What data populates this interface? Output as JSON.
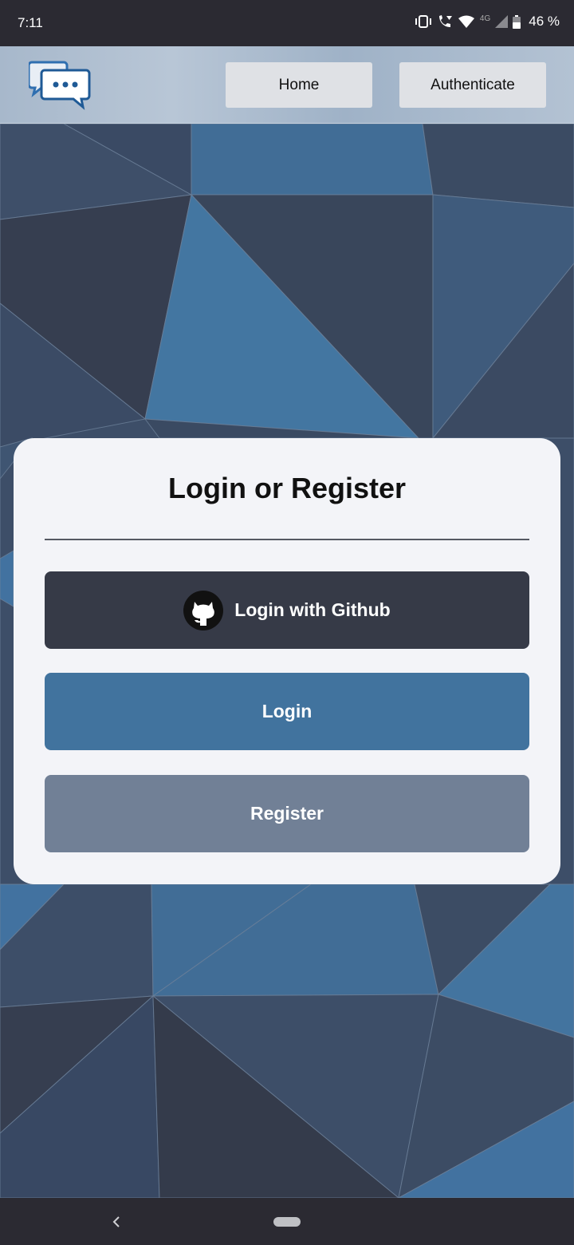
{
  "status_bar": {
    "time": "7:11",
    "battery": "46 %",
    "network": "4G",
    "icons": [
      "vibrate-icon",
      "wifi-call-icon",
      "wifi-icon",
      "signal-icon",
      "battery-icon"
    ]
  },
  "header": {
    "logo_icon": "chat-bubbles-icon",
    "nav": {
      "home_label": "Home",
      "auth_label": "Authenticate"
    }
  },
  "card": {
    "title": "Login or Register",
    "github_label": "Login with Github",
    "github_icon": "github-icon",
    "login_label": "Login",
    "register_label": "Register"
  },
  "colors": {
    "github_button": "#363a47",
    "login_button": "#41739e",
    "register_button": "#718096",
    "card_bg": "#f3f4f8"
  },
  "system_nav": {
    "icons": [
      "back-icon",
      "home-pill"
    ]
  }
}
